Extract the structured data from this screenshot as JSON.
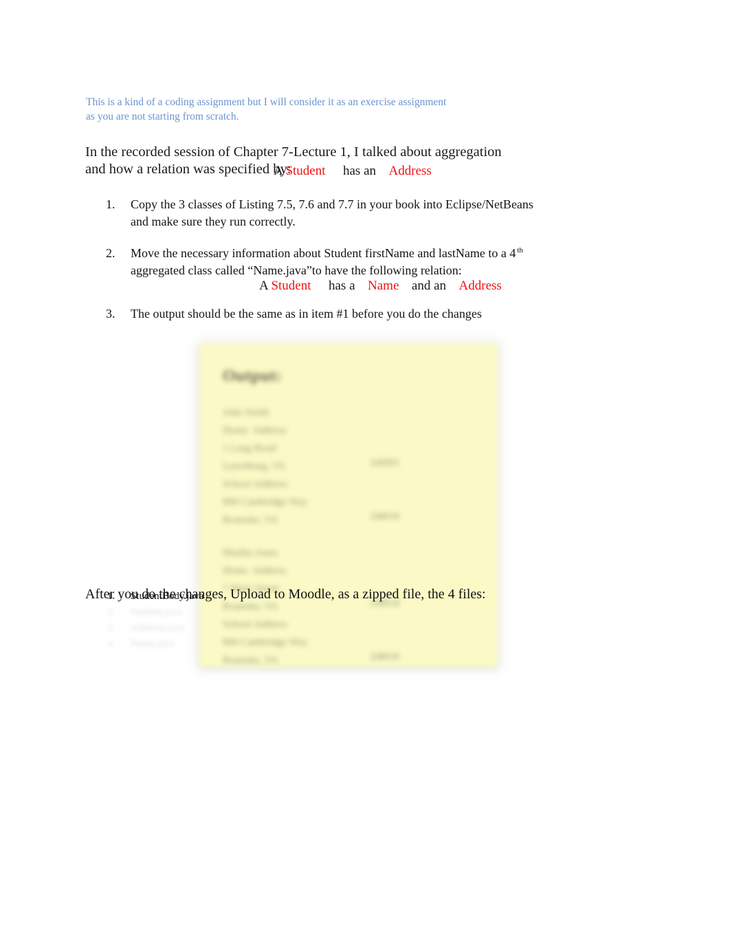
{
  "document": {
    "intro_note": "This is a kind of a coding assignment but I will consider it as an exercise assignment as you are not starting from scratch.",
    "lead_paragraph": "In the recorded session of Chapter 7-Lecture 1, I talked about aggregation and how a relation was specified by:",
    "relation_1": {
      "article": "A",
      "subject": "Student",
      "verb": "has an",
      "object": "Address"
    },
    "relation_2": {
      "article": "A",
      "subject": "Student",
      "verb_1": "has a",
      "object_1": "Name",
      "verb_2": "and an",
      "object_2": "Address"
    },
    "tasks": [
      {
        "number": "1.",
        "text": "Copy the 3 classes of Listing 7.5, 7.6 and 7.7 in your book into Eclipse/NetBeans and make sure they run correctly."
      },
      {
        "number": "2.",
        "text_before_sup": "Move the necessary information about Student firstName and lastName to a 4",
        "superscript": "th",
        "text_after_sup": "aggregated class called “Name.java”to have the following relation:"
      },
      {
        "number": "3.",
        "text": "The output should be the same as in item #1 before you do the changes"
      }
    ],
    "upload_instruction": "After you do the changes, Upload to Moodle, as a zipped file, the 4 files:",
    "files": [
      {
        "number": "1.",
        "name": "StudentBody.java",
        "legible": true
      },
      {
        "number": "2.",
        "name": "Student.java",
        "legible": false
      },
      {
        "number": "3.",
        "name": "Address.java",
        "legible": false
      },
      {
        "number": "4.",
        "name": "Name.java",
        "legible": false
      }
    ]
  },
  "screenshot": {
    "title": "Output:",
    "blocks": [
      {
        "lines": [
          "John Smith",
          "Home  Address",
          "1 Lang Road",
          "Lynchburg, VA",
          "School Address",
          "800 Cambridge Way",
          "Roanoke, VA"
        ],
        "tags": [
          {
            "text": "24501",
            "line": 3
          },
          {
            "text": "24016",
            "line": 6
          }
        ]
      },
      {
        "lines": [
          "Martha Jones",
          "Home  Address",
          "7 Main Street",
          "Roanoke, VA",
          "School Address",
          "800 Cambridge Way",
          "Roanoke, VA"
        ],
        "tags": [
          {
            "text": "24014",
            "line": 3
          },
          {
            "text": "24016",
            "line": 6
          }
        ]
      }
    ]
  },
  "colors": {
    "intro_blue": "#6a93d0",
    "highlight_red": "#ee1111",
    "screenshot_bg": "#fbfac6",
    "body_text": "#111111"
  }
}
